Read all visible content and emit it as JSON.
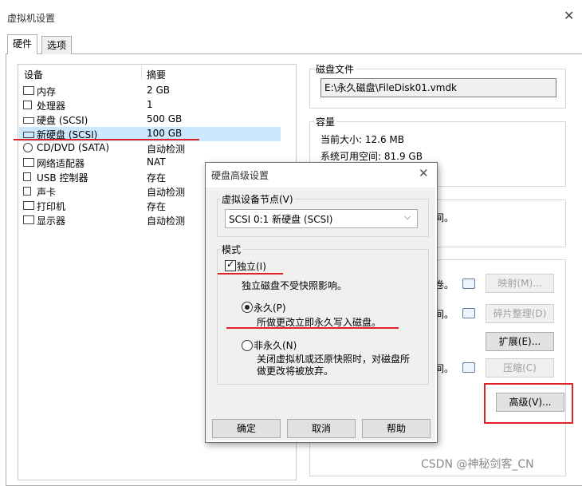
{
  "window": {
    "title": "虚拟机设置",
    "close": "✕"
  },
  "tabs": [
    {
      "label": "硬件"
    },
    {
      "label": "选项"
    }
  ],
  "device_list": {
    "headers": {
      "device": "设备",
      "summary": "摘要"
    },
    "rows": [
      {
        "name": "内存",
        "summary": "2 GB",
        "icon": "memory-icon"
      },
      {
        "name": "处理器",
        "summary": "1",
        "icon": "cpu-icon"
      },
      {
        "name": "硬盘 (SCSI)",
        "summary": "500 GB",
        "icon": "hard-disk-icon"
      },
      {
        "name": "新硬盘 (SCSI)",
        "summary": "100 GB",
        "icon": "hard-disk-icon"
      },
      {
        "name": "CD/DVD (SATA)",
        "summary": "自动检测",
        "icon": "cd-icon"
      },
      {
        "name": "网络适配器",
        "summary": "NAT",
        "icon": "network-icon"
      },
      {
        "name": "USB 控制器",
        "summary": "存在",
        "icon": "usb-icon"
      },
      {
        "name": "声卡",
        "summary": "自动检测",
        "icon": "speaker-icon"
      },
      {
        "name": "打印机",
        "summary": "存在",
        "icon": "printer-icon"
      },
      {
        "name": "显示器",
        "summary": "自动检测",
        "icon": "monitor-icon"
      }
    ]
  },
  "disk_file": {
    "title": "磁盘文件",
    "path": "E:\\永久磁盘\\FileDisk01.vmdk"
  },
  "capacity": {
    "title": "容量",
    "current_size": "当前大小: 12.6 MB",
    "free_space": "系统可用空间: 81.9 GB"
  },
  "right_panel": {
    "partial_1": "间。",
    "partial_2": "。",
    "partial_3": "卷。",
    "partial_4": "间。",
    "partial_5": "间。"
  },
  "buttons": {
    "map": "映射(M)...",
    "defrag": "碎片整理(D)",
    "expand": "扩展(E)...",
    "compact": "压缩(C)",
    "advanced": "高级(V)..."
  },
  "dialog": {
    "title": "硬盘高级设置",
    "close": "✕",
    "node_group": "虚拟设备节点(V)",
    "node_value": "SCSI 0:1   新硬盘 (SCSI)",
    "mode_group": "模式",
    "independent_label": "独立(I)",
    "independent_desc": "独立磁盘不受快照影响。",
    "persistent_label": "永久(P)",
    "persistent_desc": "所做更改立即永久写入磁盘。",
    "nonpersistent_label": "非永久(N)",
    "nonpersistent_desc_1": "关闭虚拟机或还原快照时，对磁盘所",
    "nonpersistent_desc_2": "做更改将被放弃。",
    "ok": "确定",
    "cancel": "取消",
    "help": "帮助",
    "independent_checked": true,
    "selected_mode": "persistent"
  },
  "watermark": "CSDN @神秘剑客_CN",
  "colors": {
    "annotation_red": "#e0232b",
    "selection": "#cce8ff"
  }
}
